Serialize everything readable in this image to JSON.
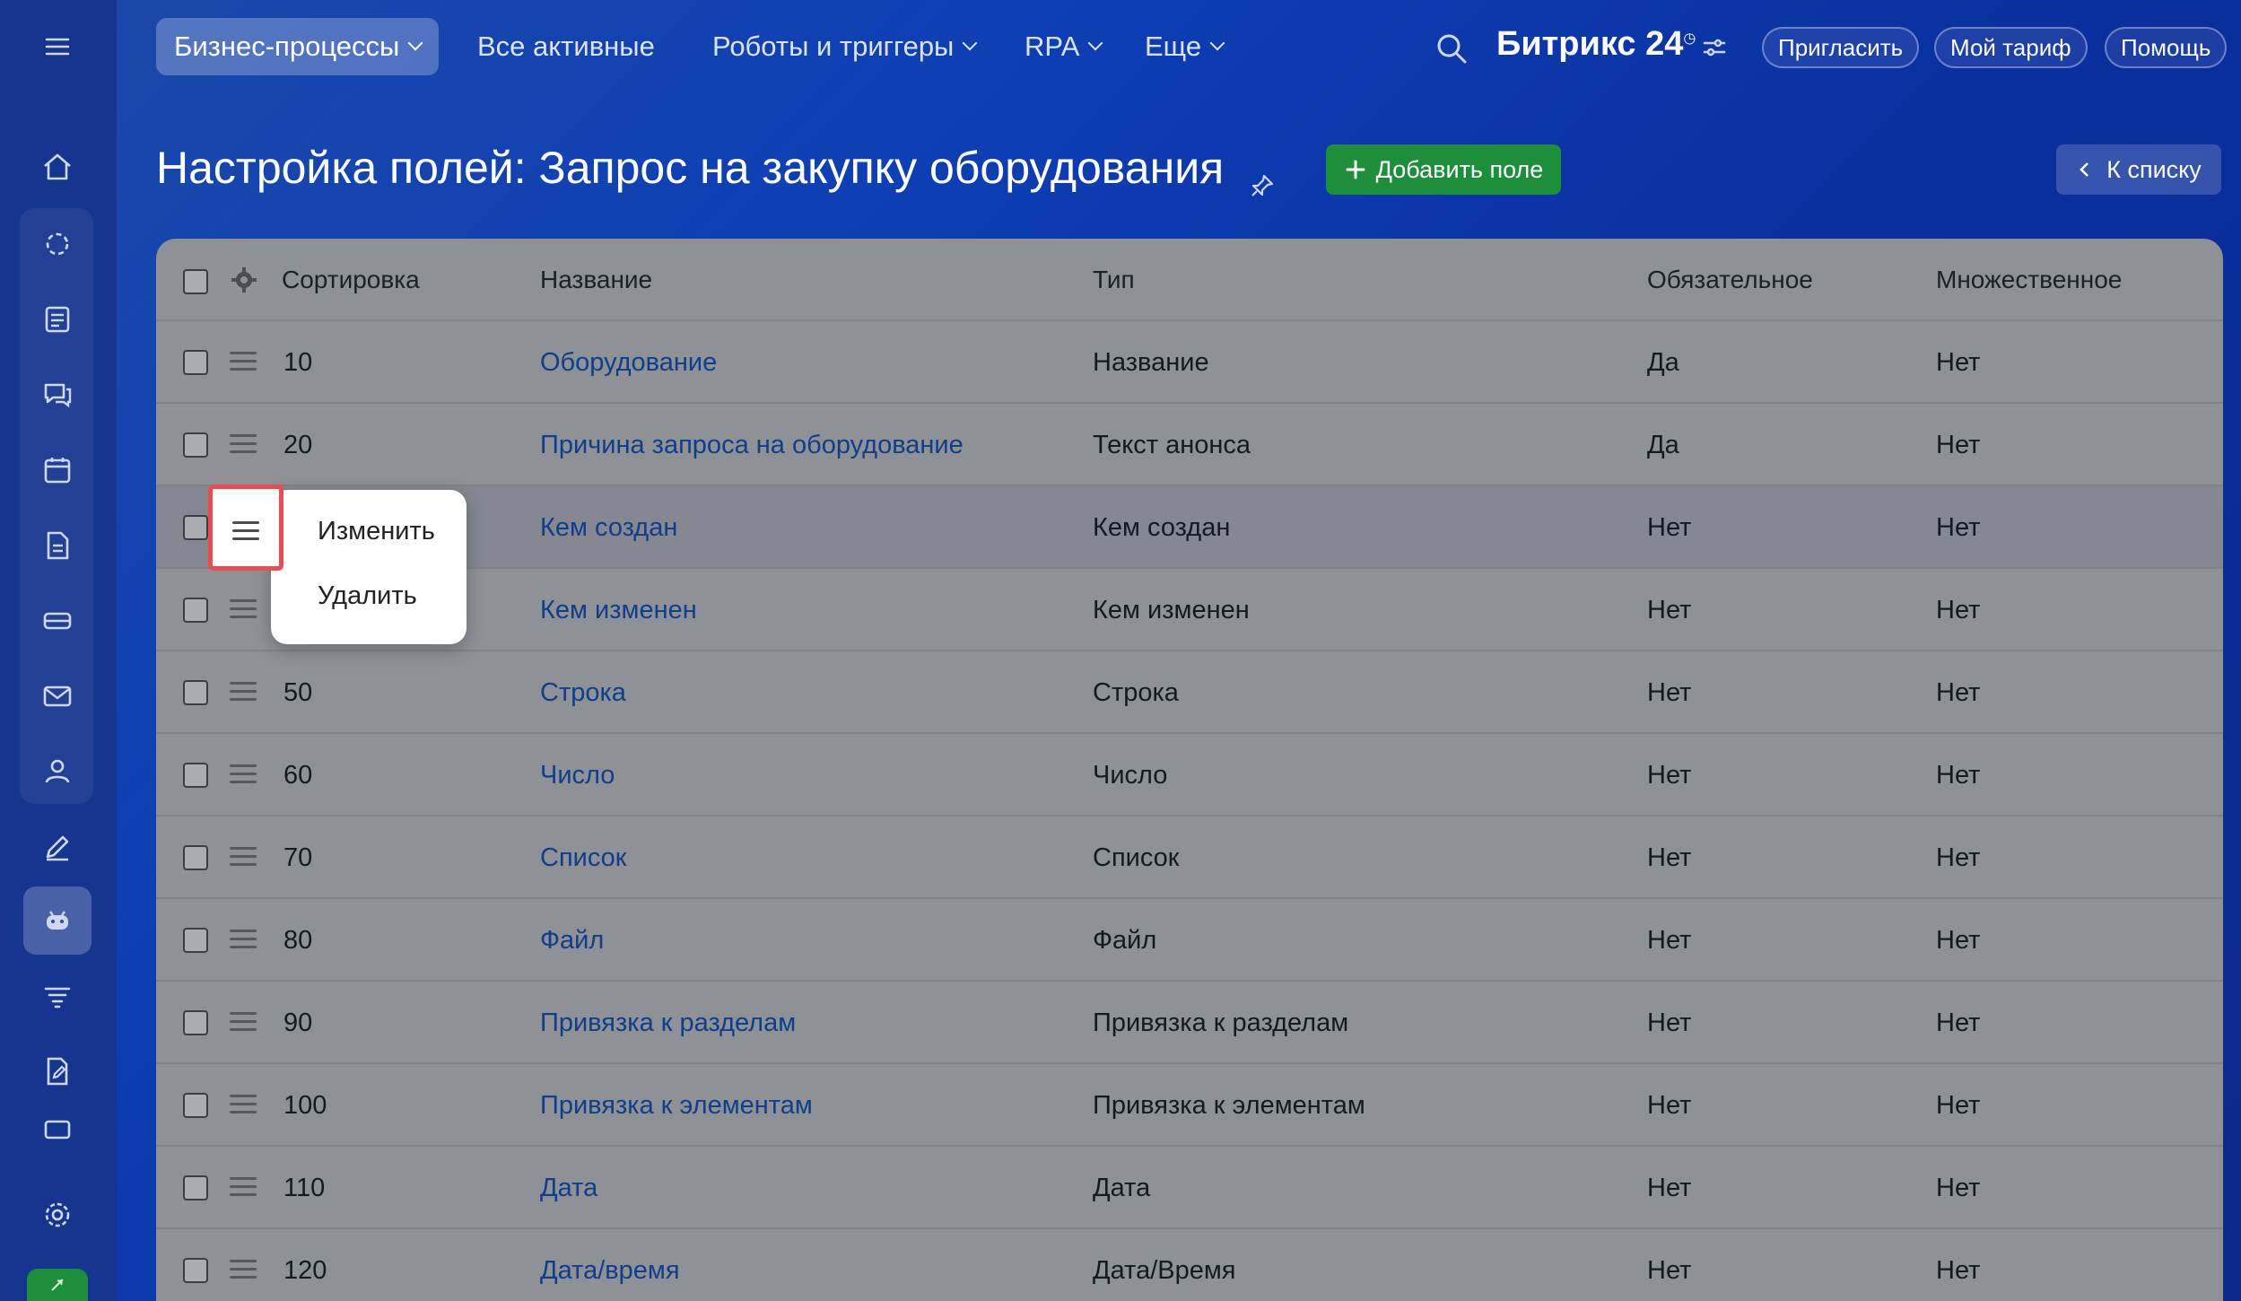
{
  "topbar": {
    "nav": [
      {
        "label": "Бизнес-процессы",
        "active": true,
        "dropdown": true
      },
      {
        "label": "Все активные",
        "active": false,
        "dropdown": false
      },
      {
        "label": "Роботы и триггеры",
        "active": false,
        "dropdown": true
      },
      {
        "label": "RPA",
        "active": false,
        "dropdown": true
      },
      {
        "label": "Еще",
        "active": false,
        "dropdown": true
      }
    ],
    "brand": "Битрикс 24",
    "invite_label": "Пригласить",
    "tariff_label": "Мой тариф",
    "help_label": "Помощь"
  },
  "page": {
    "title": "Настройка полей: Запрос на закупку оборудования",
    "add_field_label": "Добавить поле",
    "back_label": "К списку"
  },
  "table": {
    "headers": {
      "sort": "Сортировка",
      "name": "Название",
      "type": "Тип",
      "required": "Обязательное",
      "multiple": "Множественное"
    },
    "rows": [
      {
        "sort": "10",
        "name": "Оборудование",
        "type": "Название",
        "required": "Да",
        "multiple": "Нет"
      },
      {
        "sort": "20",
        "name": "Причина запроса на оборудование",
        "type": "Текст анонса",
        "required": "Да",
        "multiple": "Нет"
      },
      {
        "sort": "",
        "name": "Кем создан",
        "type": "Кем создан",
        "required": "Нет",
        "multiple": "Нет"
      },
      {
        "sort": "",
        "name": "Кем изменен",
        "type": "Кем изменен",
        "required": "Нет",
        "multiple": "Нет"
      },
      {
        "sort": "50",
        "name": "Строка",
        "type": "Строка",
        "required": "Нет",
        "multiple": "Нет"
      },
      {
        "sort": "60",
        "name": "Число",
        "type": "Число",
        "required": "Нет",
        "multiple": "Нет"
      },
      {
        "sort": "70",
        "name": "Список",
        "type": "Список",
        "required": "Нет",
        "multiple": "Нет"
      },
      {
        "sort": "80",
        "name": "Файл",
        "type": "Файл",
        "required": "Нет",
        "multiple": "Нет"
      },
      {
        "sort": "90",
        "name": "Привязка к разделам",
        "type": "Привязка к разделам",
        "required": "Нет",
        "multiple": "Нет"
      },
      {
        "sort": "100",
        "name": "Привязка к элементам",
        "type": "Привязка к элементам",
        "required": "Нет",
        "multiple": "Нет"
      },
      {
        "sort": "110",
        "name": "Дата",
        "type": "Дата",
        "required": "Нет",
        "multiple": "Нет"
      },
      {
        "sort": "120",
        "name": "Дата/время",
        "type": "Дата/Время",
        "required": "Нет",
        "multiple": "Нет"
      }
    ]
  },
  "context_menu": {
    "edit_label": "Изменить",
    "delete_label": "Удалить"
  },
  "colors": {
    "accent_green": "#1d8f3a",
    "highlight_red": "#ee4a52",
    "link_blue": "#0f3e8a"
  }
}
